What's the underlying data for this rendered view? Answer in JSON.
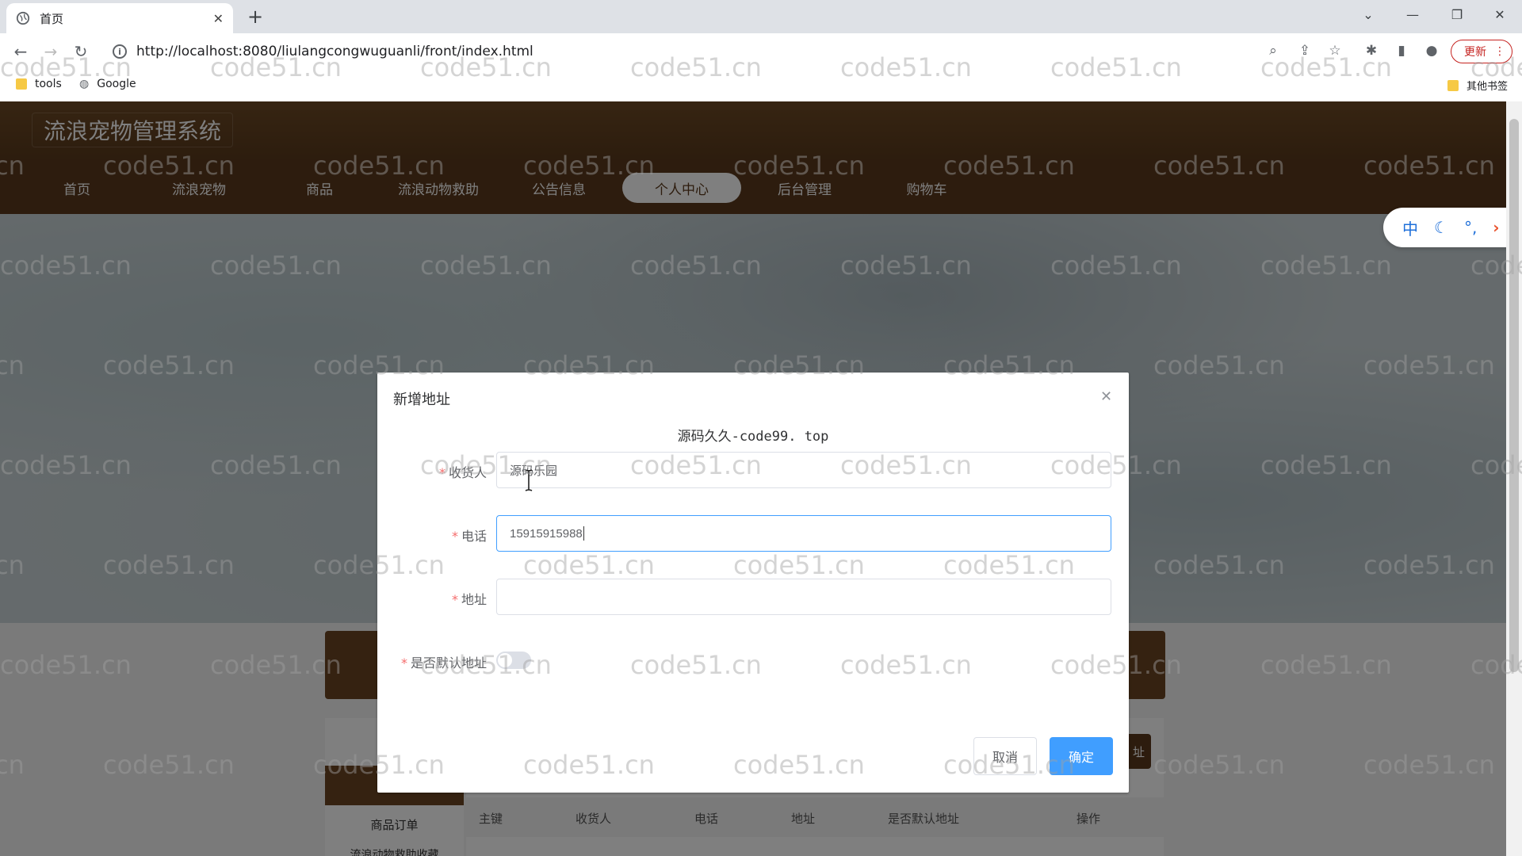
{
  "browser": {
    "tab_title": "首页",
    "url": "http://localhost:8080/liulangcongwuguanli/front/index.html",
    "update_label": "更新",
    "bookmarks": [
      "tools",
      "Google"
    ],
    "other_bookmarks": "其他书签"
  },
  "site": {
    "title": "流浪宠物管理系统",
    "nav": [
      "首页",
      "流浪宠物",
      "商品",
      "流浪动物救助",
      "公告信息",
      "个人中心",
      "后台管理",
      "购物车"
    ],
    "active_nav": "个人中心"
  },
  "background": {
    "menu_item": "商品订单",
    "menu_item2": "流浪动物救助收藏",
    "add_button_tail": "址",
    "table_headers": [
      "主键",
      "收货人",
      "电话",
      "地址",
      "是否默认地址",
      "操作"
    ]
  },
  "translator": {
    "lang": "中",
    "moon_icon": "moon-icon",
    "punct": "°,",
    "arrow": "›"
  },
  "dialog": {
    "title": "新增地址",
    "subtitle": "源码久久-code99. top",
    "fields": [
      {
        "label": "收货人",
        "value": "源码乐园"
      },
      {
        "label": "电话",
        "value": "15915915988"
      },
      {
        "label": "地址",
        "value": ""
      },
      {
        "label": "是否默认地址",
        "value": ""
      }
    ],
    "cancel": "取消",
    "confirm": "确定"
  },
  "watermark": "code51.cn",
  "colors": {
    "header_brown": "#5a391c",
    "primary": "#409eff",
    "required": "#f56c6c"
  }
}
